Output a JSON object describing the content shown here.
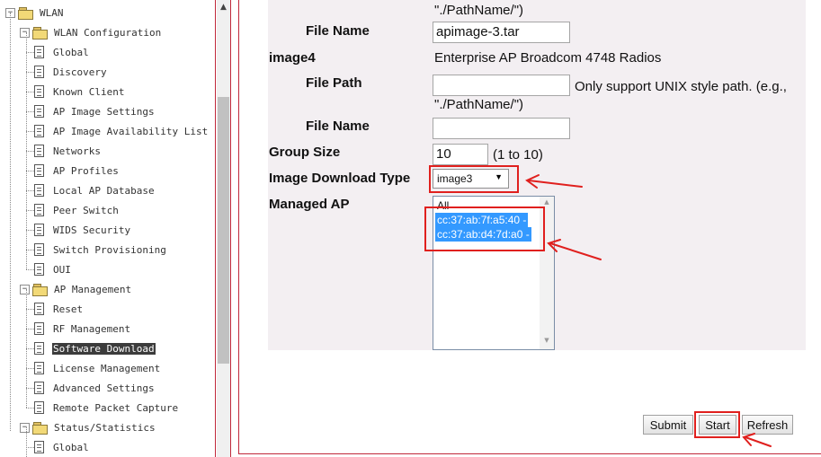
{
  "tree": {
    "items": [
      {
        "label": "WLAN",
        "level": 0,
        "kind": "folder",
        "toggle": "−",
        "selected": false
      },
      {
        "label": "WLAN Configuration",
        "level": 1,
        "kind": "folder",
        "toggle": "−",
        "selected": false
      },
      {
        "label": "Global",
        "level": 2,
        "kind": "doc",
        "selected": false
      },
      {
        "label": "Discovery",
        "level": 2,
        "kind": "doc",
        "selected": false
      },
      {
        "label": "Known Client",
        "level": 2,
        "kind": "doc",
        "selected": false
      },
      {
        "label": "AP Image Settings",
        "level": 2,
        "kind": "doc",
        "selected": false
      },
      {
        "label": "AP Image Availability List",
        "level": 2,
        "kind": "doc",
        "selected": false
      },
      {
        "label": "Networks",
        "level": 2,
        "kind": "doc",
        "selected": false
      },
      {
        "label": "AP Profiles",
        "level": 2,
        "kind": "doc",
        "selected": false
      },
      {
        "label": "Local AP Database",
        "level": 2,
        "kind": "doc",
        "selected": false
      },
      {
        "label": "Peer Switch",
        "level": 2,
        "kind": "doc",
        "selected": false
      },
      {
        "label": "WIDS Security",
        "level": 2,
        "kind": "doc",
        "selected": false
      },
      {
        "label": "Switch Provisioning",
        "level": 2,
        "kind": "doc",
        "selected": false
      },
      {
        "label": "OUI",
        "level": 2,
        "kind": "doc",
        "selected": false
      },
      {
        "label": "AP Management",
        "level": 1,
        "kind": "folder",
        "toggle": "−",
        "selected": false
      },
      {
        "label": "Reset",
        "level": 2,
        "kind": "doc",
        "selected": false
      },
      {
        "label": "RF Management",
        "level": 2,
        "kind": "doc",
        "selected": false
      },
      {
        "label": "Software Download",
        "level": 2,
        "kind": "doc",
        "selected": true
      },
      {
        "label": "License Management",
        "level": 2,
        "kind": "doc",
        "selected": false
      },
      {
        "label": "Advanced Settings",
        "level": 2,
        "kind": "doc",
        "selected": false
      },
      {
        "label": "Remote Packet Capture",
        "level": 2,
        "kind": "doc",
        "selected": false
      },
      {
        "label": "Status/Statistics",
        "level": 1,
        "kind": "folder",
        "toggle": "−",
        "selected": false
      },
      {
        "label": "Global",
        "level": 2,
        "kind": "doc",
        "selected": false
      }
    ]
  },
  "form": {
    "top_path_hint": "\"./PathName/\")",
    "file_name_label_1": "File Name",
    "file_name_value_1": "apimage-3.tar",
    "image4_label": "image4",
    "image4_desc": "Enterprise AP Broadcom 4748 Radios",
    "file_path_label": "File Path",
    "file_path_value": "",
    "file_path_hint_line1": "Only support UNIX style path. (e.g.,",
    "file_path_hint_line2": "\"./PathName/\")",
    "file_name_label_2": "File Name",
    "file_name_value_2": "",
    "group_size_label": "Group Size",
    "group_size_value": "10",
    "group_size_range": "(1 to 10)",
    "image_download_type_label": "Image Download Type",
    "image_download_type_value": "image3",
    "managed_ap_label": "Managed AP",
    "managed_ap_options": [
      {
        "label": "All",
        "selected": false
      },
      {
        "label": "cc:37:ab:7f:a5:40 -",
        "selected": true
      },
      {
        "label": "cc:37:ab:d4:7d:a0 -",
        "selected": true
      }
    ]
  },
  "buttons": {
    "submit": "Submit",
    "start": "Start",
    "refresh": "Refresh"
  },
  "icons": {
    "select_arrow": "▼",
    "scroll_up": "▲",
    "list_up": "▲",
    "list_down": "▼"
  },
  "colors": {
    "highlight": "#e0201e",
    "selection": "#3399ff",
    "frame_border": "#c0283b",
    "form_background": "#f3eff2"
  }
}
